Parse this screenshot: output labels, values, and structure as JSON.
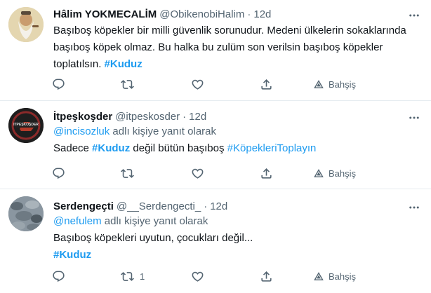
{
  "tweets": [
    {
      "name": "Hâlim YOKMECALİM",
      "handle": "@ObikenobiHalim",
      "sep": "·",
      "time": "12d",
      "lines": [
        [
          {
            "t": "Başıboş köpekler bir milli güvenlik sorunudur. Medeni ülkelerin sokaklarında"
          }
        ],
        [
          {
            "t": "başıboş köpek olmaz. Bu halka bu zulüm son verilsin başıboş köpekler"
          }
        ],
        [
          {
            "t": "toplatılsın. "
          },
          {
            "t": "#Kuduz"
          }
        ]
      ],
      "actions": {
        "retweet_count": "",
        "tip_label": "Bahşiş"
      }
    },
    {
      "name": "İtpeşkoşder",
      "handle": "@itpeskosder",
      "sep": "·",
      "time": "12d",
      "reply_to_user": "@incisozluk",
      "reply_to_suffix": " adlı kişiye yanıt olarak",
      "lines": [
        [
          {
            "t": "Sadece "
          },
          {
            "t": "#Kuduz"
          },
          {
            "t": " değil bütün başıboş "
          },
          {
            "t": "#KöpekleriToplayın"
          }
        ]
      ],
      "avatar_text": "İTPEŞKOŞDER",
      "actions": {
        "retweet_count": "",
        "tip_label": "Bahşiş"
      }
    },
    {
      "name": "Serdengeçti",
      "handle": "@__Serdengecti_",
      "sep": "·",
      "time": "12d",
      "reply_to_user": "@nefulem",
      "reply_to_suffix": " adlı kişiye yanıt olarak",
      "lines": [
        [
          {
            "t": "Başıboş köpekleri uyutun, çocukları değil..."
          }
        ],
        [
          {
            "t": "#Kuduz"
          }
        ]
      ],
      "actions": {
        "retweet_count": "1",
        "tip_label": "Bahşiş"
      }
    }
  ],
  "colors": {
    "link": "#1d9bf0",
    "muted": "#536471",
    "text": "#0f1419",
    "divider": "#e6ecf0"
  }
}
